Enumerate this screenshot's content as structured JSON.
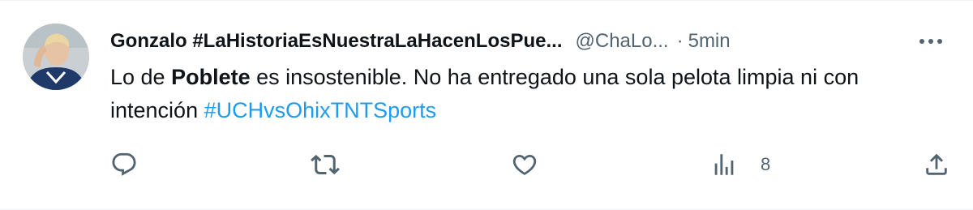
{
  "tweet": {
    "display_name": "Gonzalo #LaHistoriaEsNuestraLaHacenLosPue...",
    "handle": "@ChaLo...",
    "separator": "·",
    "time": "5min",
    "text": {
      "part1": "Lo de ",
      "bold": "Poblete",
      "part2": " es insostenible. No ha entregado una sola pelota limpia ni con intención ",
      "hashtag": "#UCHvsOhixTNTSports"
    }
  },
  "actions": {
    "views_count": "8"
  },
  "icons": {
    "more": "more-dots-icon",
    "reply": "reply-icon",
    "retweet": "retweet-icon",
    "like": "heart-icon",
    "views": "views-icon",
    "share": "share-icon"
  },
  "colors": {
    "text": "#0f1419",
    "secondary": "#536471",
    "link": "#1d9bf0"
  }
}
